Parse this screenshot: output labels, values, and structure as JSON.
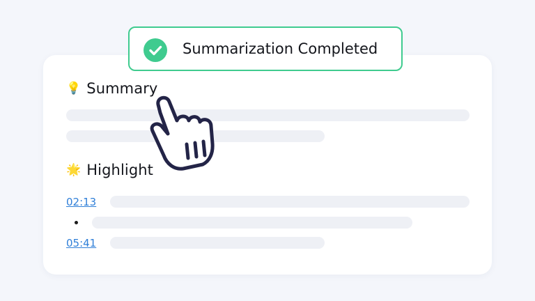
{
  "toast": {
    "text": "Summarization Completed",
    "icon": "check-circle-icon",
    "accent_color": "#3fcb8f"
  },
  "summary": {
    "emoji": "💡",
    "title": "Summary"
  },
  "highlight": {
    "emoji": "🌟",
    "title": "Highlight",
    "timestamps": [
      "02:13",
      "05:41"
    ]
  },
  "cursor": {
    "icon": "hand-pointer-icon"
  },
  "colors": {
    "background": "#f4f6fb",
    "card": "#ffffff",
    "skeleton": "#eef0f5",
    "link": "#2f7fd8"
  }
}
